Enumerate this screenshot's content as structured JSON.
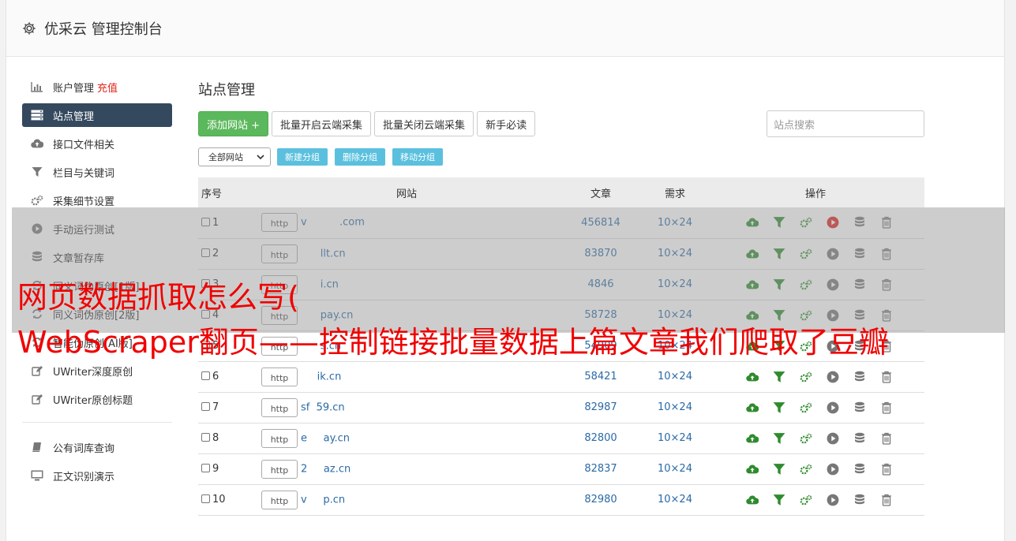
{
  "header": {
    "title": "优采云 管理控制台"
  },
  "sidebar": {
    "items": [
      {
        "label": "账户管理",
        "extra": "充值",
        "icon": "bar-chart-icon"
      },
      {
        "label": "站点管理",
        "icon": "server-list-icon"
      },
      {
        "label": "接口文件相关",
        "icon": "cloud-upload-icon"
      },
      {
        "label": "栏目与关键词",
        "icon": "filter-icon"
      },
      {
        "label": "采集细节设置",
        "icon": "gears-icon"
      },
      {
        "label": "手动运行测试",
        "icon": "play-circle-icon"
      },
      {
        "label": "文章暂存库",
        "icon": "database-icon"
      },
      {
        "label": "同义词伪原创[1版]",
        "icon": "refresh-icon"
      },
      {
        "label": "同义词伪原创[2版]",
        "icon": "refresh-icon"
      },
      {
        "label": "智能伪原创[AI版]",
        "icon": "refresh-icon"
      },
      {
        "label": "UWriter深度原创",
        "icon": "edit-icon"
      },
      {
        "label": "UWriter原创标题",
        "icon": "edit-icon"
      },
      {
        "label": "公有词库查询",
        "icon": "book-icon"
      },
      {
        "label": "正文识别演示",
        "icon": "monitor-icon"
      }
    ]
  },
  "main": {
    "title": "站点管理",
    "buttons": {
      "add_site": "添加网站 +",
      "batch_open": "批量开启云端采集",
      "batch_close": "批量关闭云端采集",
      "beginner": "新手必读"
    },
    "search_placeholder": "站点搜索",
    "group_select": "全部网站",
    "group_buttons": {
      "new": "新建分组",
      "delete": "删除分组",
      "move": "移动分组"
    },
    "table": {
      "headers": {
        "no": "序号",
        "site": "网站",
        "articles": "文章",
        "demand": "需求",
        "ops": "操作"
      },
      "http_label": "http",
      "rows": [
        {
          "no": "1",
          "site": "v          .com",
          "articles": "456814",
          "demand": "10×24",
          "run_active": true
        },
        {
          "no": "2",
          "site": "      llt.cn",
          "articles": "83870",
          "demand": "10×24",
          "run_active": false
        },
        {
          "no": "3",
          "site": "      i.cn",
          "articles": "4846",
          "demand": "10×24",
          "run_active": false
        },
        {
          "no": "4",
          "site": "      pay.cn",
          "articles": "58728",
          "demand": "10×24",
          "run_active": false
        },
        {
          "no": "5",
          "site": "      s.cn",
          "articles": "54909",
          "demand": "10×24",
          "run_active": false
        },
        {
          "no": "6",
          "site": "     ik.cn",
          "articles": "58421",
          "demand": "10×24",
          "run_active": false
        },
        {
          "no": "7",
          "site": "sf  59.cn",
          "articles": "82987",
          "demand": "10×24",
          "run_active": false
        },
        {
          "no": "8",
          "site": "e     ay.cn",
          "articles": "82800",
          "demand": "10×24",
          "run_active": false
        },
        {
          "no": "9",
          "site": "2     az.cn",
          "articles": "82837",
          "demand": "10×24",
          "run_active": false
        },
        {
          "no": "10",
          "site": "v     p.cn",
          "articles": "82980",
          "demand": "10×24",
          "run_active": false
        }
      ]
    }
  },
  "overlay_text": {
    "line1": "网页数据抓取怎么写(",
    "line2": "WebScraper翻页——控制链接批量数据上篇文章我们爬取了豆瓣"
  },
  "colors": {
    "sidebar_active_bg": "#34495e",
    "add_button": "#5cb85c",
    "group_button": "#5bc0de",
    "link_blue": "#2a6aa5",
    "overlay_text": "#f00000",
    "recharge_red": "#e0271b",
    "run_active_red": "#e02020"
  }
}
